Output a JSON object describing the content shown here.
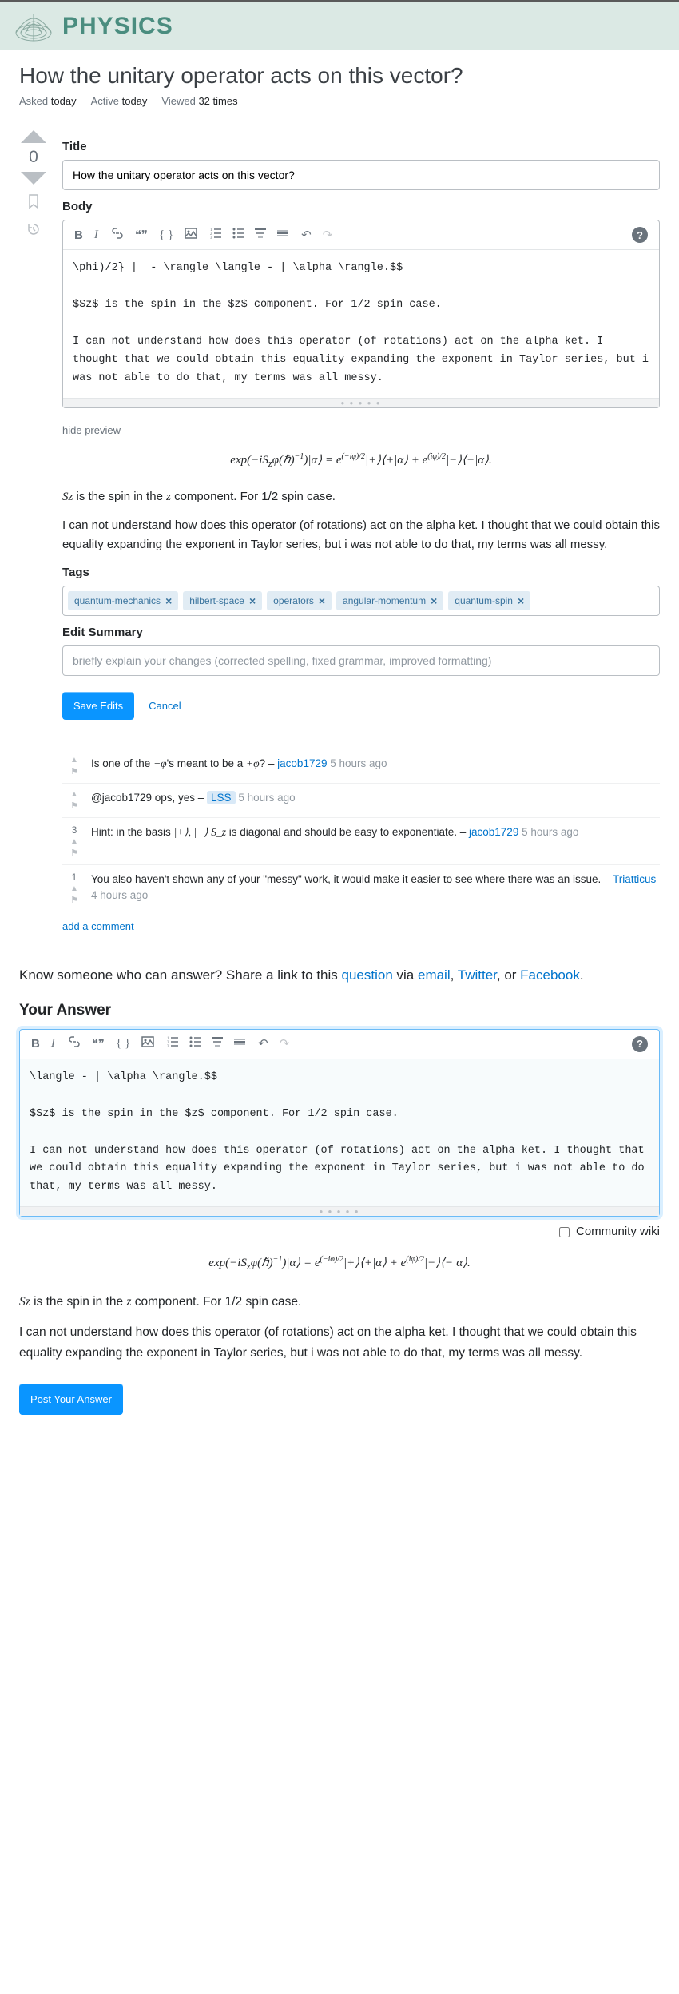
{
  "site": {
    "name": "PHYSICS"
  },
  "question": {
    "title": "How the unitary operator acts on this vector?",
    "asked_label": "Asked",
    "asked_value": "today",
    "active_label": "Active",
    "active_value": "today",
    "viewed_label": "Viewed",
    "viewed_value": "32 times",
    "vote_count": "0"
  },
  "edit_form": {
    "title_label": "Title",
    "title_value": "How the unitary operator acts on this vector?",
    "body_label": "Body",
    "body_text": "\\phi)/2} |  - \\rangle \\langle - | \\alpha \\rangle.$$\n\n$Sz$ is the spin in the $z$ component. For 1/2 spin case.\n\nI can not understand how does this operator (of rotations) act on the alpha ket. I thought that we could obtain this equality expanding the exponent in Taylor series, but i was not able to do that, my terms was all messy.",
    "hide_preview": "hide preview",
    "preview_formula": "exp(−iS_zφ(ℏ)⁻¹)|α⟩ = e^{(−iφ)/2}|+⟩⟨+|α⟩ + e^{(iφ)/2}|−⟩⟨−|α⟩.",
    "preview_sz": "Sz",
    "preview_sz_text": " is the spin in the ",
    "preview_z": "z",
    "preview_sz_end": " component. For 1/2 spin case.",
    "preview_para": "I can not understand how does this operator (of rotations) act on the alpha ket. I thought that we could obtain this equality expanding the exponent in Taylor series, but i was not able to do that, my terms was all messy.",
    "tags_label": "Tags",
    "tags": [
      "quantum-mechanics",
      "hilbert-space",
      "operators",
      "angular-momentum",
      "quantum-spin"
    ],
    "summary_label": "Edit Summary",
    "summary_placeholder": "briefly explain your changes (corrected spelling, fixed grammar, improved formatting)",
    "save_btn": "Save Edits",
    "cancel_btn": "Cancel"
  },
  "comments": [
    {
      "score": "",
      "text_pre": "Is one of the ",
      "math1": "−φ",
      "text_mid": "'s meant to be a ",
      "math2": "+φ",
      "text_post": "? – ",
      "user": "jacob1729",
      "user_owner": false,
      "time": "5 hours ago"
    },
    {
      "score": "",
      "text_pre": "@jacob1729 ops, yes – ",
      "math1": "",
      "text_mid": "",
      "math2": "",
      "text_post": "",
      "user": "LSS",
      "user_owner": true,
      "time": "5 hours ago"
    },
    {
      "score": "3",
      "text_pre": "Hint: in the basis ",
      "math1": "|+⟩, |−⟩",
      "text_mid": " ",
      "math2": "S_z",
      "text_post": " is diagonal and should be easy to exponentiate. – ",
      "user": "jacob1729",
      "user_owner": false,
      "time": "5 hours ago"
    },
    {
      "score": "1",
      "text_pre": "You also haven't shown any of your \"messy\" work, it would make it easier to see where there was an issue. – ",
      "math1": "",
      "text_mid": "",
      "math2": "",
      "text_post": "",
      "user": "Triatticus",
      "user_owner": false,
      "time": "4 hours ago"
    }
  ],
  "add_comment": "add a comment",
  "share": {
    "pre": "Know someone who can answer? Share a link to this ",
    "question": "question",
    "via": " via ",
    "email": "email",
    "twitter": "Twitter",
    "or": ", or ",
    "facebook": "Facebook",
    "end": "."
  },
  "answer": {
    "heading": "Your Answer",
    "body_text": "\\langle - | \\alpha \\rangle.$$\n\n$Sz$ is the spin in the $z$ component. For 1/2 spin case.\n\nI can not understand how does this operator (of rotations) act on the alpha ket. I thought that we could obtain this equality expanding the exponent in Taylor series, but i was not able to do that, my terms was all messy.",
    "cw_label": "Community wiki",
    "preview_formula": "exp(−iS_zφ(ℏ)⁻¹)|α⟩ = e^{(−iφ)/2}|+⟩⟨+|α⟩ + e^{(iφ)/2}|−⟩⟨−|α⟩.",
    "preview_sz": "Sz",
    "preview_sz_text": " is the spin in the ",
    "preview_z": "z",
    "preview_sz_end": " component. For 1/2 spin case.",
    "preview_para": "I can not understand how does this operator (of rotations) act on the alpha ket. I thought that we could obtain this equality expanding the exponent in Taylor series, but i was not able to do that, my terms was all messy.",
    "post_btn": "Post Your Answer"
  }
}
